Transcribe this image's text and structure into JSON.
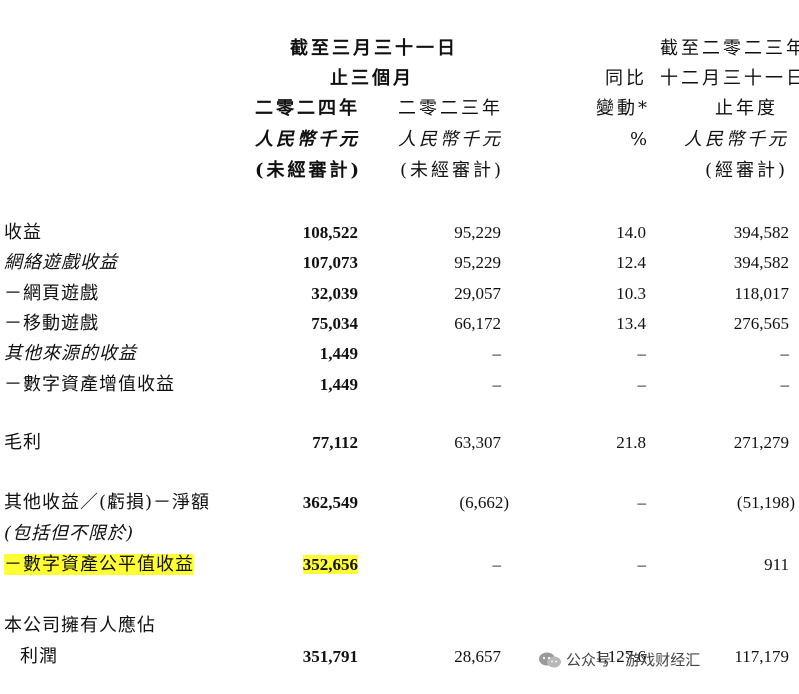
{
  "header": {
    "q_period_l1": "截至三月三十一日",
    "q_period_l2": "止三個月",
    "col_2024": "二零二四年",
    "col_2023": "二零二三年",
    "currency_2024": "人民幣千元",
    "currency_2023": "人民幣千元",
    "audit_2024": "(未經審計)",
    "audit_2023": "(未經審計)",
    "yoy_l1": "同比",
    "yoy_l2": "變動*",
    "yoy_unit": "%",
    "fy_l1": "截至二零二三年",
    "fy_l2": "十二月三十一日",
    "fy_l3": "止年度",
    "fy_currency": "人民幣千元",
    "fy_audit": "(經審計)"
  },
  "rows": [
    {
      "label": "收益",
      "v2024": "108,522",
      "v2023": "95,229",
      "yoy": "14.0",
      "fy": "394,582"
    },
    {
      "label": "網絡遊戲收益",
      "v2024": "107,073",
      "v2023": "95,229",
      "yoy": "12.4",
      "fy": "394,582"
    },
    {
      "label": "－網頁遊戲",
      "v2024": "32,039",
      "v2023": "29,057",
      "yoy": "10.3",
      "fy": "118,017"
    },
    {
      "label": "－移動遊戲",
      "v2024": "75,034",
      "v2023": "66,172",
      "yoy": "13.4",
      "fy": "276,565"
    },
    {
      "label": "其他來源的收益",
      "v2024": "1,449",
      "v2023": "–",
      "yoy": "–",
      "fy": "–"
    },
    {
      "label": "－數字資產增值收益",
      "v2024": "1,449",
      "v2023": "–",
      "yoy": "–",
      "fy": "–"
    },
    {
      "label": "毛利",
      "v2024": "77,112",
      "v2023": "63,307",
      "yoy": "21.8",
      "fy": "271,279"
    },
    {
      "label": "其他收益／(虧損)－淨額",
      "v2024": "362,549",
      "v2023": "(6,662)",
      "yoy": "–",
      "fy": "(51,198)"
    },
    {
      "label": "(包括但不限於)"
    },
    {
      "label": "－數字資產公平值收益",
      "v2024": "352,656",
      "v2023": "–",
      "yoy": "–",
      "fy": "911"
    },
    {
      "label": "本公司擁有人應佔"
    },
    {
      "label": "利潤",
      "v2024": "351,791",
      "v2023": "28,657",
      "yoy": "1,127.6",
      "fy": "117,179"
    }
  ],
  "watermark": {
    "icon": "wechat-icon",
    "text": "公众号 · 游戏财经汇"
  },
  "colors": {
    "highlight": "#ffff33"
  }
}
